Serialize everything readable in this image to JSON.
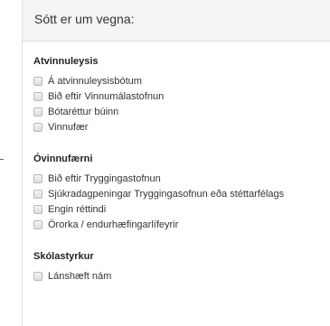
{
  "panel": {
    "heading": "Sótt er um vegna:"
  },
  "groups": [
    {
      "title": "Atvinnuleysis",
      "options": [
        {
          "label": "Á atvinnuleysisbótum",
          "checked": false
        },
        {
          "label": "Bið eftir Vinnumálastofnun",
          "checked": false
        },
        {
          "label": "Bótaréttur búinn",
          "checked": false
        },
        {
          "label": "Vinnufær",
          "checked": false
        }
      ]
    },
    {
      "title": "Óvinnufærni",
      "options": [
        {
          "label": "Bið eftir Tryggingastofnun",
          "checked": false
        },
        {
          "label": "Sjúkradagpeningar Tryggingasofnun eða stéttarfélags",
          "checked": false
        },
        {
          "label": "Engin réttindi",
          "checked": false
        },
        {
          "label": "Örorka / endurhæfingarlífeyrir",
          "checked": false
        }
      ]
    },
    {
      "title": "Skólastyrkur",
      "options": [
        {
          "label": "Lánshæft nám",
          "checked": false
        }
      ]
    }
  ]
}
